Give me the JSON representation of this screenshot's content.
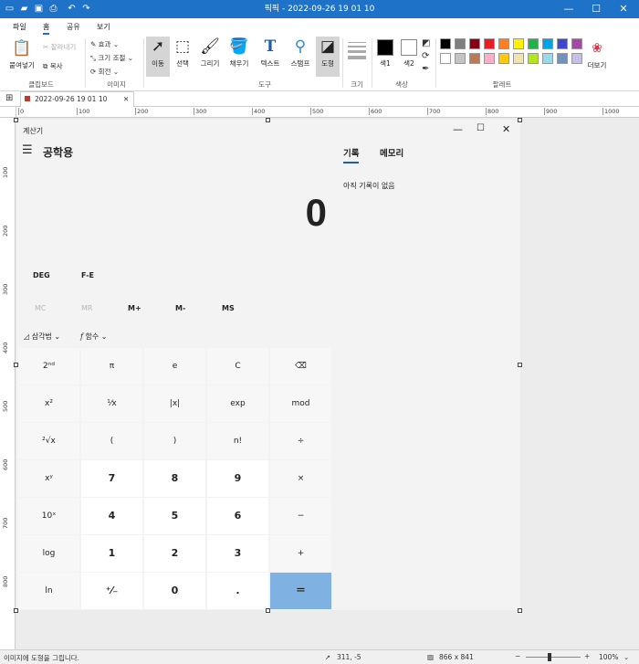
{
  "titlebar": {
    "title": "픽픽 - 2022-09-26 19 01 10"
  },
  "menu": {
    "tabs": [
      "파일",
      "홈",
      "공유",
      "보기"
    ]
  },
  "ribbon": {
    "paste": "붙여넣기",
    "cut": "잘라내기",
    "copy": "복사",
    "clipboard_group": "클립보드",
    "effect": "효과",
    "resize": "크기 조절",
    "rotate": "회전",
    "image_group": "이미지",
    "tools": [
      "이동",
      "선택",
      "그리기",
      "채우기",
      "텍스트",
      "스탬프",
      "도형"
    ],
    "tools_group": "도구",
    "size_group": "크기",
    "color1": "색1",
    "color2": "색2",
    "color_group": "색상",
    "palette_group": "팔레트",
    "more": "더보기",
    "palette_colors": [
      "#000000",
      "#7f7f7f",
      "#880015",
      "#ed1c24",
      "#ff7f27",
      "#fff200",
      "#22b14c",
      "#00a2e8",
      "#3f48cc",
      "#a349a4",
      "#ffffff",
      "#c3c3c3",
      "#b97a57",
      "#ffaec9",
      "#ffc90e",
      "#efe4b0",
      "#b5e61d",
      "#99d9ea",
      "#7092be",
      "#c8bfe7"
    ]
  },
  "doc_tab": {
    "label": "2022-09-26 19 01 10"
  },
  "ruler": {
    "h": [
      "0",
      "100",
      "200",
      "300",
      "400",
      "500",
      "600",
      "700",
      "800",
      "900",
      "1000"
    ],
    "v": [
      "100",
      "200",
      "300",
      "400",
      "500",
      "600",
      "700",
      "800"
    ]
  },
  "calculator": {
    "window_title": "계산기",
    "mode": "공학용",
    "display": "0",
    "history_tab": "기록",
    "memory_tab": "메모리",
    "history_empty": "아직 기록이 없음",
    "angle": "DEG",
    "fe": "F-E",
    "memory": [
      "MC",
      "MR",
      "M+",
      "M-",
      "MS"
    ],
    "trig": "삼각법",
    "func": "함수",
    "keys": [
      [
        "2ⁿᵈ",
        "π",
        "e",
        "C",
        "⌫"
      ],
      [
        "x²",
        "¹⁄x",
        "|x|",
        "exp",
        "mod"
      ],
      [
        "²√x",
        "(",
        ")",
        "n!",
        "÷"
      ],
      [
        "xʸ",
        "7",
        "8",
        "9",
        "×"
      ],
      [
        "10ˣ",
        "4",
        "5",
        "6",
        "−"
      ],
      [
        "log",
        "1",
        "2",
        "3",
        "+"
      ],
      [
        "ln",
        "⁺⁄₋",
        "0",
        ".",
        "="
      ]
    ]
  },
  "status": {
    "hint": "이미지에 도형을 그립니다.",
    "cursor": "311, -5",
    "size": "866 x 841",
    "zoom": "100%"
  }
}
